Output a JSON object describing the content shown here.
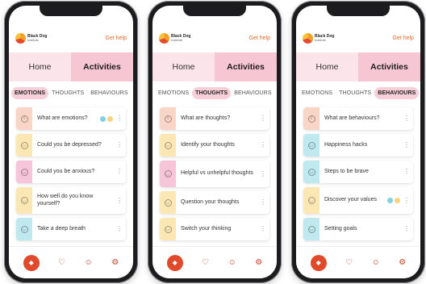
{
  "topbar": {
    "logo_title": "Black Dog",
    "logo_sub": "Institute",
    "help": "Get help"
  },
  "tabs": {
    "home": "Home",
    "activities": "Activities"
  },
  "subtabs": {
    "emotions": "EMOTIONS",
    "thoughts": "THOUGHTS",
    "behaviours": "BEHAVIOURS"
  },
  "phones": [
    {
      "selected_subtab": "EMOTIONS",
      "items": [
        {
          "label": "What are emotions?",
          "color": "#f8d5c7",
          "icon": "info-icon",
          "badges": true
        },
        {
          "label": "Could you be depressed?",
          "color": "#fbe7b4",
          "icon": "smile-icon"
        },
        {
          "label": "Could you be anxious?",
          "color": "#f7c5d8",
          "icon": "smile-icon"
        },
        {
          "label": "How well do you know yourself?",
          "color": "#fbe7b4",
          "icon": "smile-icon"
        },
        {
          "label": "Take a deep breath",
          "color": "#bfe8ef",
          "icon": "smile-icon"
        }
      ]
    },
    {
      "selected_subtab": "THOUGHTS",
      "items": [
        {
          "label": "What are thoughts?",
          "color": "#f8d5c7",
          "icon": "info-icon"
        },
        {
          "label": "Identify your thoughts",
          "color": "#fbe7b4",
          "icon": "smile-icon"
        },
        {
          "label": "Helpful vs unhelpful thoughts",
          "color": "#f7c5d8",
          "icon": "smile-icon"
        },
        {
          "label": "Question your thoughts",
          "color": "#fbe7b4",
          "icon": "smile-icon"
        },
        {
          "label": "Switch your thinking",
          "color": "#fbe7b4",
          "icon": "smile-icon"
        }
      ]
    },
    {
      "selected_subtab": "BEHAVIOURS",
      "items": [
        {
          "label": "What are behaviours?",
          "color": "#f8d5c7",
          "icon": "info-icon"
        },
        {
          "label": "Happiness hacks",
          "color": "#bfe8ef",
          "icon": "smile-icon"
        },
        {
          "label": "Steps to be brave",
          "color": "#bfe8ef",
          "icon": "smile-icon"
        },
        {
          "label": "Discover your values",
          "color": "#fbe7b4",
          "icon": "smile-icon",
          "badges": true
        },
        {
          "label": "Setting goals",
          "color": "#bfe8ef",
          "icon": "smile-icon"
        }
      ]
    }
  ],
  "colors": {
    "accent": "#e26a2c",
    "tab_active": "#f6c6d3",
    "tab_inactive": "#fbe4ea"
  }
}
